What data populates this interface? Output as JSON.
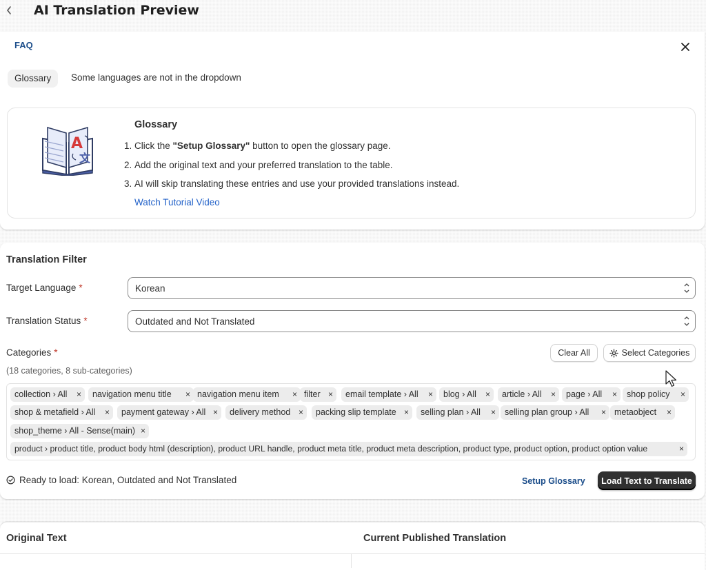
{
  "header": {
    "title": "AI Translation Preview"
  },
  "faq": {
    "label": "FAQ",
    "tabs": [
      "Glossary",
      "Some languages are not in the dropdown"
    ],
    "glossary": {
      "title": "Glossary",
      "step1_prefix": "Click the ",
      "step1_bold": "\"Setup Glossary\"",
      "step1_suffix": " button to open the glossary page.",
      "step2": "Add the original text and your preferred translation to the table.",
      "step3": "AI will skip translating these entries and use your provided translations instead.",
      "video_link": "Watch Tutorial Video"
    }
  },
  "filter": {
    "title": "Translation Filter",
    "target_language_label": "Target Language",
    "target_language_value": "Korean",
    "status_label": "Translation Status",
    "status_value": "Outdated and Not Translated",
    "required_mark": "*",
    "categories_label": "Categories",
    "clear_all": "Clear All",
    "select_categories": "Select Categories",
    "count_text": "(18 categories, 8 sub-categories)",
    "tags": [
      "collection › All",
      "navigation menu title",
      "navigation menu item",
      "filter",
      "email template › All",
      "blog › All",
      "article › All",
      "page › All",
      "shop policy",
      "shop & metafield › All",
      "payment gateway › All",
      "delivery method",
      "packing slip template",
      "selling plan › All",
      "selling plan group › All",
      "metaobject",
      "shop_theme › All - Sense(main)",
      "product › product title, product body html (description), product URL handle, product meta title, product meta description, product type, product option, product option value"
    ],
    "remove_glyph": "×",
    "ready_text": "Ready to load: Korean, Outdated and Not Translated",
    "setup_glossary": "Setup Glossary",
    "load_button": "Load Text to Translate"
  },
  "table": {
    "columns": [
      "Original Text",
      "Current Published Translation"
    ]
  },
  "colors": {
    "primary_button": "#303030",
    "link": "#2463c9",
    "heading_link": "#1b4d8a",
    "required": "#c0392b"
  }
}
